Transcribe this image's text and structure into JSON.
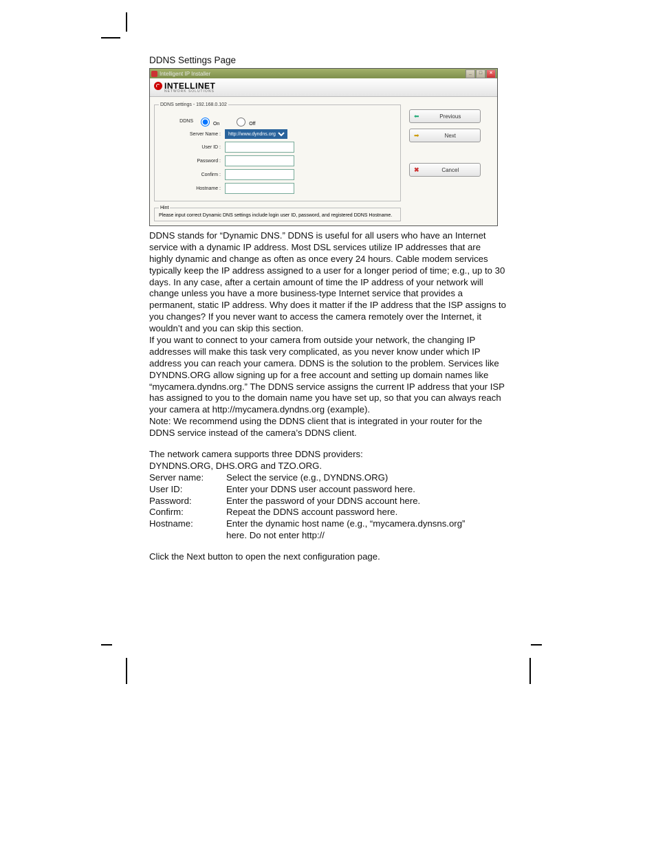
{
  "section_title": "DDNS Settings Page",
  "window": {
    "title": "Intelligent IP Installer",
    "brand": "INTELLINET",
    "brand_sub": "NETWORK SOLUTIONS",
    "fieldset_legend": "DDNS settings - 192.168.0.102",
    "labels": {
      "ddns": "DDNS",
      "on": "On",
      "off": "Off",
      "server_name": "Server Name :",
      "user_id": "User ID :",
      "password": "Password :",
      "confirm": "Confirm :",
      "hostname": "Hostname :"
    },
    "server_option": "http://www.dyndns.org",
    "hint_legend": "Hint",
    "hint_text": "Please input correct Dynamic DNS settings include login user ID, password, and registered DDNS Hostname.",
    "buttons": {
      "previous": "Previous",
      "next": "Next",
      "cancel": "Cancel"
    }
  },
  "paragraphs": {
    "p1": "DDNS stands for “Dynamic DNS.” DDNS is useful for all users who have an Internet service with a dynamic IP address. Most DSL services utilize IP addresses that are highly dynamic and change as often as once every 24 hours. Cable modem services typically keep the IP address assigned to a user for a longer period of time; e.g., up to 30 days. In any case, after a certain amount of time the IP address of your network will change unless you have a more business-type Internet service that provides a permanent, static IP address. Why does it matter if the IP address that the ISP assigns to you changes? If you never want to access the camera remotely over the Internet, it wouldn’t and you can skip this section.",
    "p2": "If you want to connect to your camera from outside your network, the changing IP addresses will make this task very complicated, as you never know under which IP address you can reach your camera. DDNS is the solution to the problem. Services like DYNDNS.ORG allow signing up for a free account and setting up domain names like “mycamera.dyndns.org.” The DDNS service assigns the current IP address that your ISP has assigned to you to the domain name you have set up, so that you can always reach your camera at http://mycamera.dyndns.org (example).",
    "p3": "Note: We recommend using the DDNS client that is integrated in your router for the DDNS service instead of the camera’s DDNS client.",
    "p4": "The network camera supports three DDNS providers:",
    "p5": "DYNDNS.ORG, DHS.ORG and TZO.ORG.",
    "defs": {
      "server_name_k": "Server name:",
      "server_name_v": "Select the service (e.g., DYNDNS.ORG)",
      "user_id_k": "User ID:",
      "user_id_v": "Enter your DDNS user account password here.",
      "password_k": "Password:",
      "password_v": "Enter the password of your DDNS account here.",
      "confirm_k": "Confirm:",
      "confirm_v": "Repeat the DDNS account password here.",
      "hostname_k": "Hostname:",
      "hostname_v": "Enter the dynamic host name (e.g., “mycamera.dynsns.org”",
      "hostname_v2": "here. Do not enter http://"
    },
    "p6": "Click the Next button to open the next configuration page."
  }
}
